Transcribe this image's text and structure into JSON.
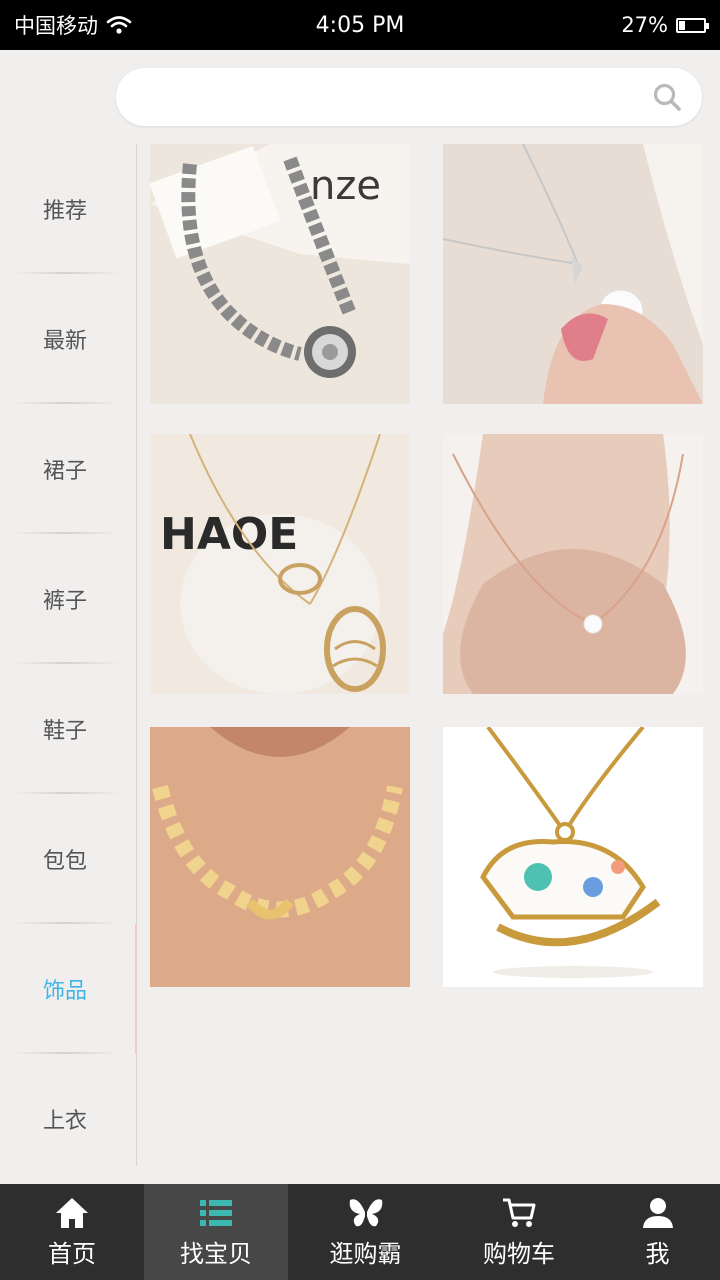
{
  "status_bar": {
    "carrier": "中国移动",
    "time": "4:05 PM",
    "battery_percent": "27%",
    "battery_level": 0.27
  },
  "search": {
    "value": "",
    "placeholder": "",
    "icon": "search-icon"
  },
  "categories": [
    {
      "label": "推荐",
      "active": false
    },
    {
      "label": "最新",
      "active": false
    },
    {
      "label": "裙子",
      "active": false
    },
    {
      "label": "裤子",
      "active": false
    },
    {
      "label": "鞋子",
      "active": false
    },
    {
      "label": "包包",
      "active": false
    },
    {
      "label": "饰品",
      "active": true
    },
    {
      "label": "上衣",
      "active": false
    }
  ],
  "products": [
    {
      "image": "silver-chain-necklace"
    },
    {
      "image": "pearl-pendant-necklace"
    },
    {
      "image": "gold-oval-pendant-necklace"
    },
    {
      "image": "single-pearl-necklace"
    },
    {
      "image": "gold-wave-choker"
    },
    {
      "image": "rocking-horse-pendant"
    }
  ],
  "bottom_nav": [
    {
      "label": "首页",
      "icon": "home-icon",
      "active": false
    },
    {
      "label": "找宝贝",
      "icon": "list-icon",
      "active": true
    },
    {
      "label": "逛购霸",
      "icon": "butterfly-icon",
      "active": false
    },
    {
      "label": "购物车",
      "icon": "cart-icon",
      "active": false
    },
    {
      "label": "我",
      "icon": "user-icon",
      "active": false
    }
  ],
  "colors": {
    "accent": "#3fb5e6",
    "nav_background": "#2e2e2e",
    "nav_active": "#474747",
    "page_background": "#f1eeee"
  }
}
